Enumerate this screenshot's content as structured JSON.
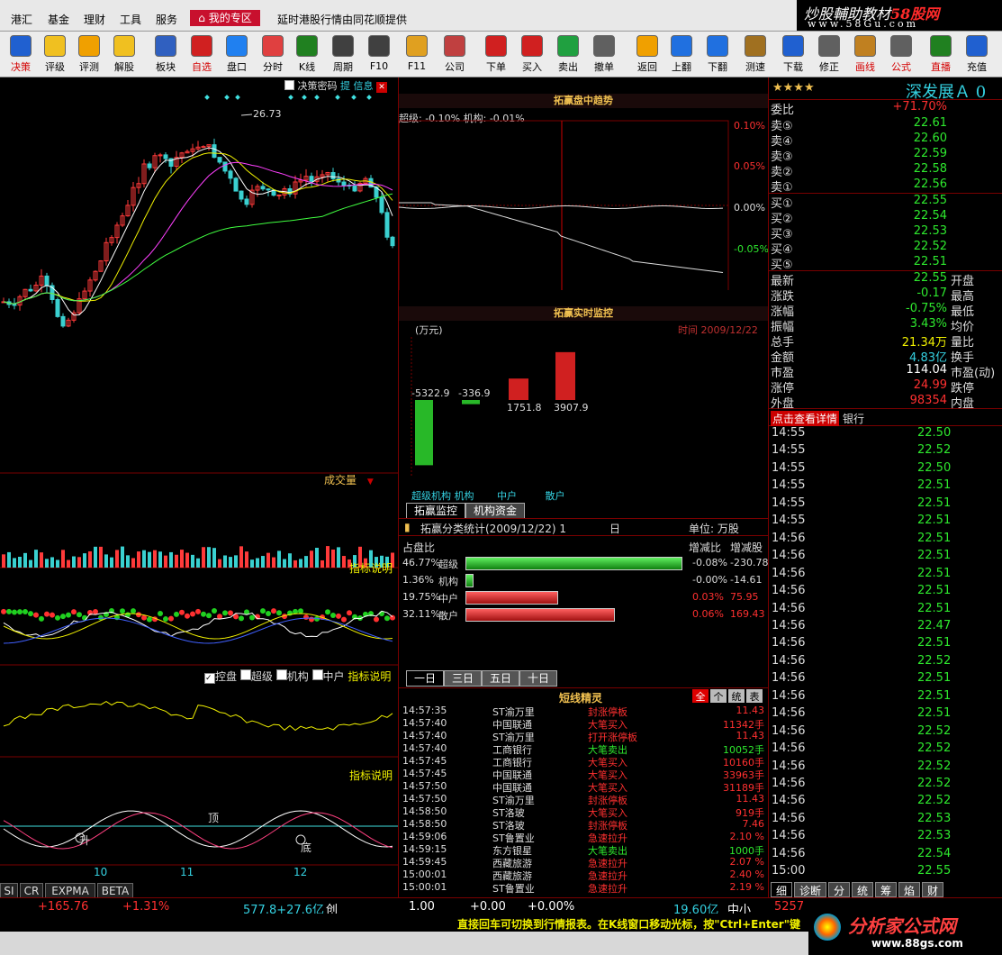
{
  "menu": {
    "items": [
      "港汇",
      "基金",
      "理财",
      "工具",
      "服务"
    ],
    "my_zone": "我的专区",
    "notice": "延时港股行情由同花顺提供"
  },
  "logo": {
    "line1a": "炒股輔助教材",
    "line1b": "58股网",
    "line2": "www.58Gu.com"
  },
  "toolbar": [
    {
      "label": "决策",
      "color": "#d40000",
      "icon": "globe-icon"
    },
    {
      "label": "评级",
      "color": "#000",
      "icon": "stars-icon"
    },
    {
      "label": "评测",
      "color": "#000",
      "icon": "question-icon"
    },
    {
      "label": "解股",
      "color": "#000",
      "icon": "bulb-icon"
    },
    {
      "label": "板块",
      "color": "#000",
      "icon": "blocks-icon"
    },
    {
      "label": "自选",
      "color": "#d40000",
      "icon": "star-list-icon"
    },
    {
      "label": "盘口",
      "color": "#000",
      "icon": "pie-icon"
    },
    {
      "label": "分时",
      "color": "#000",
      "icon": "line-chart-icon"
    },
    {
      "label": "K线",
      "color": "#000",
      "icon": "candle-icon"
    },
    {
      "label": "周期",
      "color": "#000",
      "icon": "f8-icon"
    },
    {
      "label": "F10",
      "color": "#000",
      "icon": "f10-icon"
    },
    {
      "label": "F11",
      "color": "#000",
      "icon": "check-icon"
    },
    {
      "label": "公司",
      "color": "#000",
      "icon": "company-icon"
    },
    {
      "label": "下单",
      "color": "#000",
      "icon": "down-arrow-icon"
    },
    {
      "label": "买入",
      "color": "#000",
      "icon": "buy-icon"
    },
    {
      "label": "卖出",
      "color": "#000",
      "icon": "sell-icon"
    },
    {
      "label": "撤单",
      "color": "#000",
      "icon": "cancel-icon"
    },
    {
      "label": "返回",
      "color": "#000",
      "icon": "back-icon"
    },
    {
      "label": "上翻",
      "color": "#000",
      "icon": "up-icon"
    },
    {
      "label": "下翻",
      "color": "#000",
      "icon": "down-icon"
    },
    {
      "label": "测速",
      "color": "#000",
      "icon": "speed-icon"
    },
    {
      "label": "下载",
      "color": "#000",
      "icon": "download-icon"
    },
    {
      "label": "修正",
      "color": "#000",
      "icon": "fix-icon"
    },
    {
      "label": "画线",
      "color": "#d40000",
      "icon": "draw-icon"
    },
    {
      "label": "公式",
      "color": "#d40000",
      "icon": "formula-icon"
    },
    {
      "label": "直播",
      "color": "#d40000",
      "icon": "live-icon"
    },
    {
      "label": "充值",
      "color": "#000",
      "icon": "charge-icon"
    }
  ],
  "kline": {
    "decision_password": "决策密码",
    "info_tag": "提 信息",
    "high_label": "26.73",
    "volume_label": "成交量",
    "indicator_note_1": "指标说明",
    "indicator_note_2": "指标说明",
    "indicator_note_3": "指标说明",
    "checkboxes": [
      "控盘",
      "超级",
      "机构",
      "中户"
    ],
    "top_label": "顶",
    "bottom_label": "底",
    "up_label": "升",
    "date_ticks": [
      "10",
      "11",
      "12"
    ],
    "bottom_tabs": [
      "SI",
      "CR",
      "EXPMA",
      "BETA"
    ]
  },
  "trend": {
    "title": "拓赢盘中趋势",
    "legend": "超级: -0.10%  机构: -0.01%",
    "y_ticks": [
      "0.10%",
      "0.05%",
      "0.00%",
      "-0.05%"
    ]
  },
  "monitor": {
    "title": "拓赢实时监控",
    "unit": "(万元)",
    "time_label": "时间  2009/12/22",
    "bars": [
      {
        "name": "超级",
        "value": -5322.9,
        "label": "-5322.9"
      },
      {
        "name": "机构",
        "value": -336.9,
        "label": "-336.9"
      },
      {
        "name": "中户",
        "value": 1751.8,
        "label": "1751.8"
      },
      {
        "name": "散户",
        "value": 3907.9,
        "label": "3907.9"
      }
    ],
    "xlabels": [
      "超级机构",
      "机构",
      "中户",
      "散户"
    ],
    "tabs": [
      "拓赢监控",
      "机构资金"
    ]
  },
  "classify": {
    "title": "拓赢分类统计(2009/12/22)  1",
    "day": "日",
    "unit": "单位: 万股",
    "col_share": "占盘比",
    "col_change_ratio": "增减比",
    "col_change": "增减股",
    "rows": [
      {
        "pct": "46.77%",
        "name": "超级",
        "ratio": "-0.08%",
        "change": "-230.78",
        "fill": 0.9777,
        "color": "green"
      },
      {
        "pct": "1.36%",
        "name": "机构",
        "ratio": "-0.00%",
        "change": "-14.61",
        "fill": 0.0284,
        "color": "green"
      },
      {
        "pct": "19.75%",
        "name": "中户",
        "ratio": "0.03%",
        "change": "75.95",
        "fill": 0.4129,
        "color": "red"
      },
      {
        "pct": "32.11%",
        "name": "散户",
        "ratio": "0.06%",
        "change": "169.43",
        "fill": 0.6713,
        "color": "red"
      }
    ],
    "period_tabs": [
      "一日",
      "三日",
      "五日",
      "十日"
    ]
  },
  "elf": {
    "title": "短线精灵",
    "filters": [
      "全",
      "个",
      "统",
      "表"
    ],
    "rows": [
      {
        "time": "14:57:35",
        "stock": "ST渝万里",
        "event": "封涨停板",
        "value": "11.43"
      },
      {
        "time": "14:57:40",
        "stock": "中国联通",
        "event": "大笔买入",
        "value": "11342手"
      },
      {
        "time": "14:57:40",
        "stock": "ST渝万里",
        "event": "打开涨停板",
        "value": "11.43"
      },
      {
        "time": "14:57:40",
        "stock": "工商银行",
        "event": "大笔卖出",
        "value": "10052手"
      },
      {
        "time": "14:57:45",
        "stock": "工商银行",
        "event": "大笔买入",
        "value": "10160手"
      },
      {
        "time": "14:57:45",
        "stock": "中国联通",
        "event": "大笔买入",
        "value": "33963手"
      },
      {
        "time": "14:57:50",
        "stock": "中国联通",
        "event": "大笔买入",
        "value": "31189手"
      },
      {
        "time": "14:57:50",
        "stock": "ST渝万里",
        "event": "封涨停板",
        "value": "11.43"
      },
      {
        "time": "14:58:50",
        "stock": "ST洛玻",
        "event": "大笔买入",
        "value": "919手"
      },
      {
        "time": "14:58:50",
        "stock": "ST洛玻",
        "event": "封涨停板",
        "value": "7.46"
      },
      {
        "time": "14:59:06",
        "stock": "ST鲁置业",
        "event": "急速拉升",
        "value": "2.10 %"
      },
      {
        "time": "14:59:15",
        "stock": "东方银星",
        "event": "大笔卖出",
        "value": "1000手"
      },
      {
        "time": "14:59:45",
        "stock": "西藏旅游",
        "event": "急速拉升",
        "value": "2.07 %"
      },
      {
        "time": "15:00:01",
        "stock": "西藏旅游",
        "event": "急速拉升",
        "value": "2.40 %"
      },
      {
        "time": "15:00:01",
        "stock": "ST鲁置业",
        "event": "急速拉升",
        "value": "2.19 %"
      }
    ]
  },
  "quote": {
    "stars": "★★★★",
    "name": "深发展Ａ",
    "code_suffix": "0",
    "ratio_label": "委比",
    "ratio_value": "+71.70%",
    "asks": [
      {
        "label": "卖⑤",
        "price": "22.61"
      },
      {
        "label": "卖④",
        "price": "22.60"
      },
      {
        "label": "卖③",
        "price": "22.59"
      },
      {
        "label": "卖②",
        "price": "22.58"
      },
      {
        "label": "卖①",
        "price": "22.56"
      }
    ],
    "bids": [
      {
        "label": "买①",
        "price": "22.55"
      },
      {
        "label": "买②",
        "price": "22.54"
      },
      {
        "label": "买③",
        "price": "22.53"
      },
      {
        "label": "买④",
        "price": "22.52"
      },
      {
        "label": "买⑤",
        "price": "22.51"
      }
    ],
    "stats": [
      {
        "label": "最新",
        "value": "22.55",
        "color": "#2ee82e",
        "label2": "开盘"
      },
      {
        "label": "涨跌",
        "value": "-0.17",
        "color": "#2ee82e",
        "label2": "最高"
      },
      {
        "label": "涨幅",
        "value": "-0.75%",
        "color": "#2ee82e",
        "label2": "最低"
      },
      {
        "label": "振幅",
        "value": "3.43%",
        "color": "#2ee82e",
        "label2": "均价"
      },
      {
        "label": "总手",
        "value": "21.34万",
        "color": "#f0f000",
        "label2": "量比"
      },
      {
        "label": "金额",
        "value": "4.83亿",
        "color": "#34d0e0",
        "label2": "换手"
      },
      {
        "label": "市盈",
        "value": "114.04",
        "color": "#fff",
        "label2": "市盈(动)"
      },
      {
        "label": "涨停",
        "value": "24.99",
        "color": "#ff3030",
        "label2": "跌停"
      },
      {
        "label": "外盘",
        "value": "98354",
        "color": "#ff3030",
        "label2": "内盘"
      }
    ],
    "detail_btn": "点击查看详情",
    "sector": "银行",
    "ticks": [
      {
        "t": "14:55",
        "p": "22.50"
      },
      {
        "t": "14:55",
        "p": "22.52"
      },
      {
        "t": "14:55",
        "p": "22.50"
      },
      {
        "t": "14:55",
        "p": "22.51"
      },
      {
        "t": "14:55",
        "p": "22.51"
      },
      {
        "t": "14:55",
        "p": "22.51"
      },
      {
        "t": "14:56",
        "p": "22.51"
      },
      {
        "t": "14:56",
        "p": "22.51"
      },
      {
        "t": "14:56",
        "p": "22.51"
      },
      {
        "t": "14:56",
        "p": "22.51"
      },
      {
        "t": "14:56",
        "p": "22.51"
      },
      {
        "t": "14:56",
        "p": "22.47"
      },
      {
        "t": "14:56",
        "p": "22.51"
      },
      {
        "t": "14:56",
        "p": "22.52"
      },
      {
        "t": "14:56",
        "p": "22.51"
      },
      {
        "t": "14:56",
        "p": "22.51"
      },
      {
        "t": "14:56",
        "p": "22.51"
      },
      {
        "t": "14:56",
        "p": "22.52"
      },
      {
        "t": "14:56",
        "p": "22.52"
      },
      {
        "t": "14:56",
        "p": "22.52"
      },
      {
        "t": "14:56",
        "p": "22.52"
      },
      {
        "t": "14:56",
        "p": "22.52"
      },
      {
        "t": "14:56",
        "p": "22.53"
      },
      {
        "t": "14:56",
        "p": "22.53"
      },
      {
        "t": "14:56",
        "p": "22.54"
      },
      {
        "t": "15:00",
        "p": "22.55"
      }
    ],
    "bottom_tabs": [
      "细",
      "诊断",
      "分",
      "统",
      "筹",
      "焰",
      "财"
    ]
  },
  "status": {
    "change": "+165.76",
    "pct": "+1.31%",
    "vol": "577.8+27.6亿",
    "board": "创",
    "v1": "1.00",
    "v2": "+0.00",
    "v3": "+0.00%",
    "v4": "19.60亿",
    "v5": "中小",
    "v6": "5257"
  },
  "scroll_msg": "直接回车可切换到行情报表。在K线窗口移动光标，按\"Ctrl+Enter\"键",
  "watermark": {
    "brand": "分析家公式网",
    "url": "www.88gs.com"
  }
}
